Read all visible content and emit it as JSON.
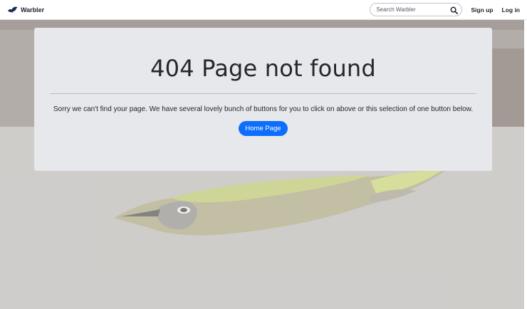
{
  "navbar": {
    "brand_name": "Warbler",
    "search_placeholder": "Search Warbler",
    "signup_label": "Sign up",
    "login_label": "Log in"
  },
  "error_card": {
    "heading": "404 Page not found",
    "message": "Sorry we can't find your page. We have several lovely bunch of buttons for you to click on above or this selection of one button below.",
    "home_button_label": "Home Page"
  },
  "colors": {
    "accent": "#0d6efd",
    "card_bg": "#e6e8eb",
    "text": "#24272b"
  },
  "icons": [
    "bird-logo-icon",
    "search-icon"
  ]
}
